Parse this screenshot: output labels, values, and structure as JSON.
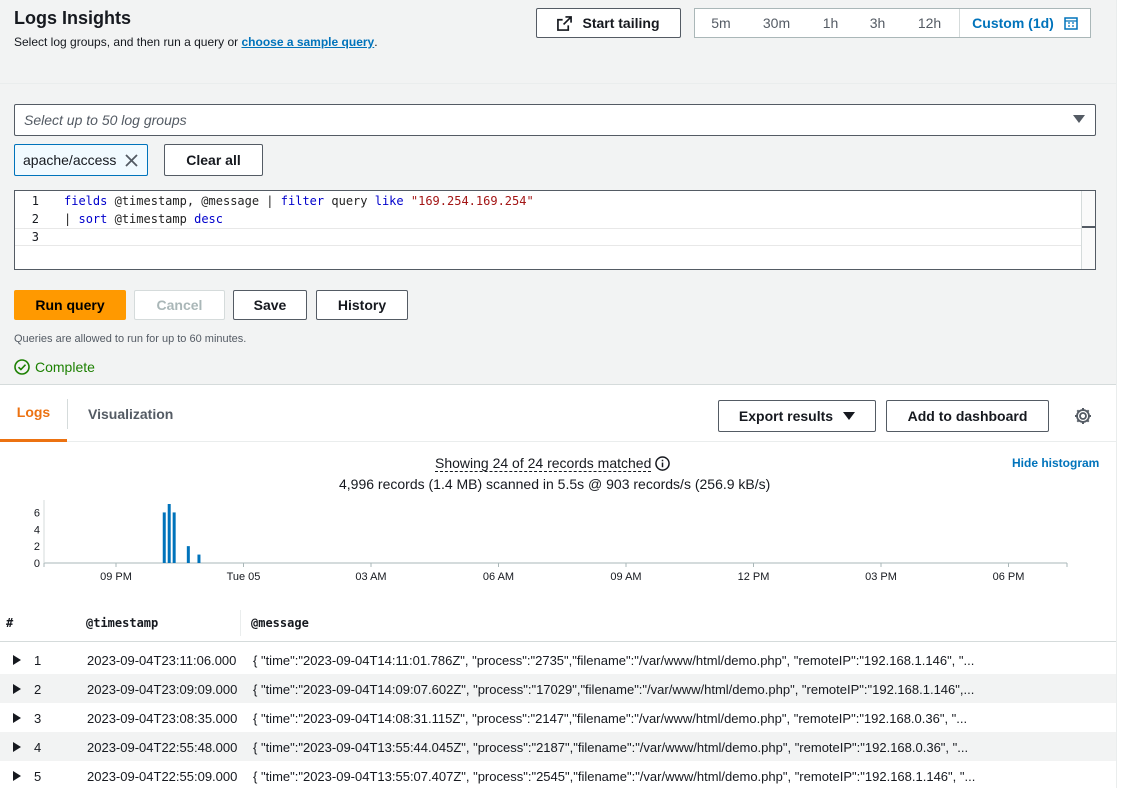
{
  "header": {
    "title": "Logs Insights",
    "subtitle_prefix": "Select log groups, and then run a query or ",
    "subtitle_link": "choose a sample query",
    "subtitle_suffix": ".",
    "start_tailing_label": "Start tailing",
    "time_ranges": [
      "5m",
      "30m",
      "1h",
      "3h",
      "12h"
    ],
    "custom_range_label": "Custom (1d)"
  },
  "log_groups": {
    "placeholder": "Select up to 50 log groups",
    "selected": [
      "apache/access"
    ],
    "clear_all_label": "Clear all"
  },
  "query_editor": {
    "lines": [
      {
        "n": "1",
        "text": "fields @timestamp, @message | filter query like \"169.254.169.254\""
      },
      {
        "n": "2",
        "text": "| sort @timestamp desc"
      },
      {
        "n": "3",
        "text": ""
      }
    ]
  },
  "actions": {
    "run_label": "Run query",
    "cancel_label": "Cancel",
    "save_label": "Save",
    "history_label": "History",
    "note": "Queries are allowed to run for up to 60 minutes.",
    "status": "Complete"
  },
  "results_tabs": {
    "logs": "Logs",
    "visualization": "Visualization",
    "export_label": "Export results",
    "dashboard_label": "Add to dashboard"
  },
  "summary": {
    "matched": "Showing 24 of 24 records matched",
    "scanned": "4,996 records (1.4 MB) scanned in 5.5s @ 903 records/s (256.9 kB/s)",
    "hide_histogram": "Hide histogram"
  },
  "chart_data": {
    "type": "bar",
    "y_ticks": [
      "0",
      "2",
      "4",
      "6"
    ],
    "ylim": [
      0,
      7
    ],
    "x_tick_labels": [
      "09 PM",
      "Tue 05",
      "03 AM",
      "06 AM",
      "09 AM",
      "12 PM",
      "03 PM",
      "06 PM"
    ],
    "bars": [
      {
        "t": "22:06",
        "value": 6
      },
      {
        "t": "22:13",
        "value": 7
      },
      {
        "t": "22:20",
        "value": 6
      },
      {
        "t": "22:40",
        "value": 2
      },
      {
        "t": "22:55",
        "value": 1
      }
    ],
    "color": "#0073bb"
  },
  "table": {
    "columns": [
      "#",
      "@timestamp",
      "@message"
    ],
    "rows": [
      {
        "n": "1",
        "ts": "2023-09-04T23:11:06.000",
        "msg": "{ \"time\":\"2023-09-04T14:11:01.786Z\", \"process\":\"2735\",\"filename\":\"/var/www/html/demo.php\", \"remoteIP\":\"192.168.1.146\", \"..."
      },
      {
        "n": "2",
        "ts": "2023-09-04T23:09:09.000",
        "msg": "{ \"time\":\"2023-09-04T14:09:07.602Z\", \"process\":\"17029\",\"filename\":\"/var/www/html/demo.php\", \"remoteIP\":\"192.168.1.146\",..."
      },
      {
        "n": "3",
        "ts": "2023-09-04T23:08:35.000",
        "msg": "{ \"time\":\"2023-09-04T14:08:31.115Z\", \"process\":\"2147\",\"filename\":\"/var/www/html/demo.php\", \"remoteIP\":\"192.168.0.36\", \"..."
      },
      {
        "n": "4",
        "ts": "2023-09-04T22:55:48.000",
        "msg": "{ \"time\":\"2023-09-04T13:55:44.045Z\", \"process\":\"2187\",\"filename\":\"/var/www/html/demo.php\", \"remoteIP\":\"192.168.0.36\", \"..."
      },
      {
        "n": "5",
        "ts": "2023-09-04T22:55:09.000",
        "msg": "{ \"time\":\"2023-09-04T13:55:07.407Z\", \"process\":\"2545\",\"filename\":\"/var/www/html/demo.php\", \"remoteIP\":\"192.168.1.146\", \"..."
      }
    ]
  }
}
